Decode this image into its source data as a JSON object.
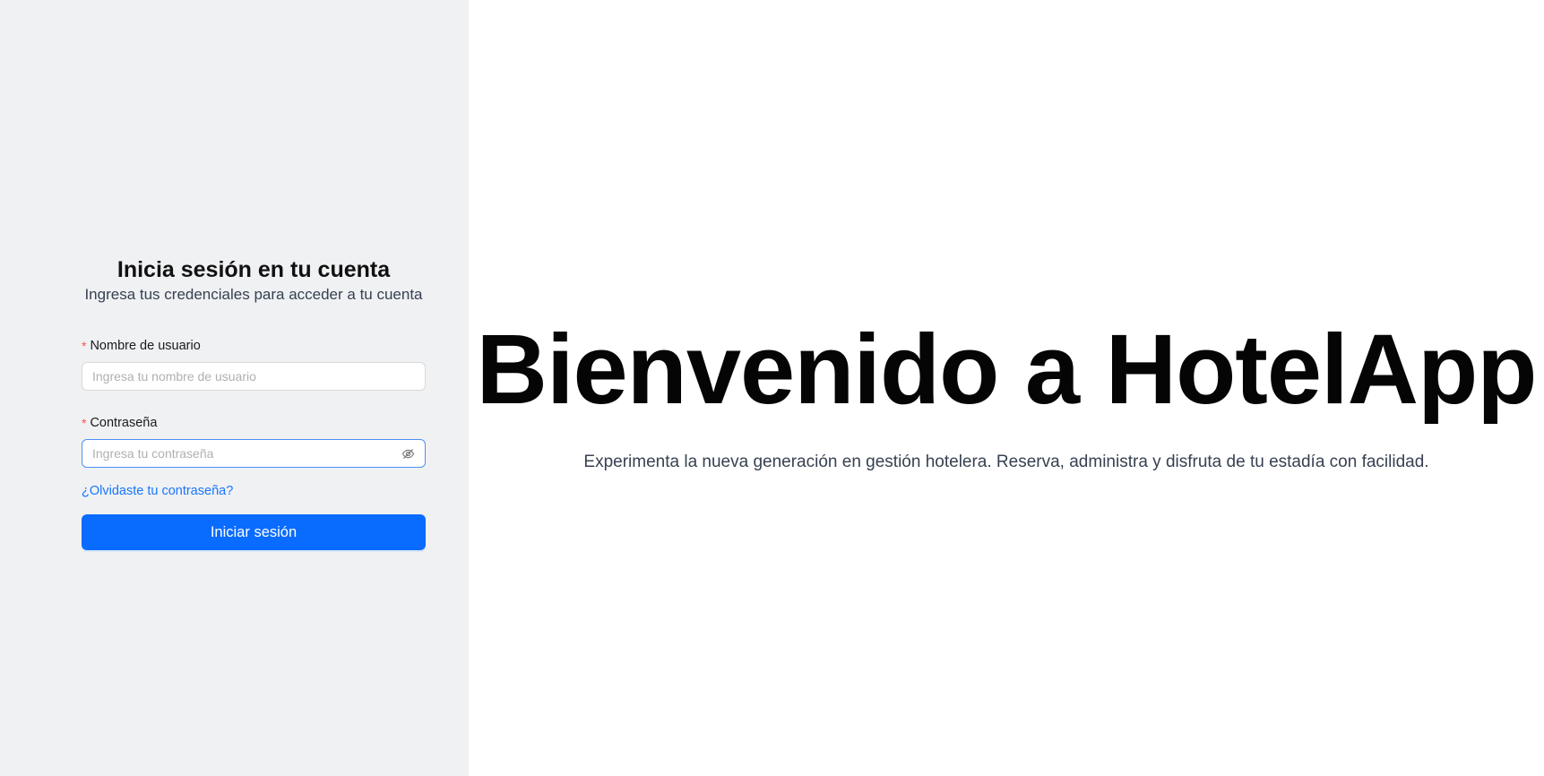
{
  "login": {
    "title": "Inicia sesión en tu cuenta",
    "subtitle": "Ingresa tus credenciales para acceder a tu cuenta",
    "username": {
      "required_mark": "*",
      "label": "Nombre de usuario",
      "placeholder": "Ingresa tu nombre de usuario",
      "value": ""
    },
    "password": {
      "required_mark": "*",
      "label": "Contraseña",
      "placeholder": "Ingresa tu contraseña",
      "value": "",
      "toggle_icon": "eye-invisible-icon"
    },
    "forgot_link": "¿Olvidaste tu contraseña?",
    "submit_label": "Iniciar sesión"
  },
  "hero": {
    "title": "Bienvenido a HotelApp",
    "subtitle": "Experimenta la nueva generación en gestión hotelera. Reserva, administra y disfruta de tu estadía con facilidad."
  },
  "colors": {
    "left_panel_bg": "#f0f1f3",
    "primary": "#0a6cff",
    "link": "#1677ff",
    "required": "#ff4d4f",
    "focus_border": "#4d8ff6"
  }
}
